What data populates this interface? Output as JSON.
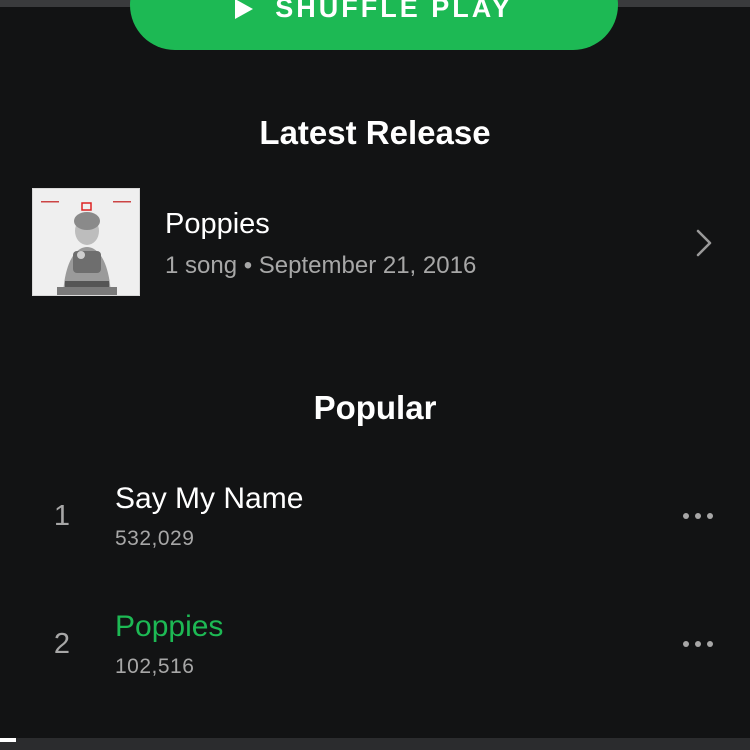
{
  "shuffle": {
    "label": "SHUFFLE PLAY"
  },
  "latest_release": {
    "heading": "Latest Release",
    "title": "Poppies",
    "meta": "1 song • September 21, 2016"
  },
  "popular": {
    "heading": "Popular",
    "tracks": [
      {
        "number": "1",
        "title": "Say My Name",
        "plays": "532,029",
        "playing": false
      },
      {
        "number": "2",
        "title": "Poppies",
        "plays": "102,516",
        "playing": true
      }
    ]
  },
  "colors": {
    "background": "#121314",
    "accent": "#1db954",
    "secondary_text": "#a7a7a7"
  },
  "icons": [
    "play-icon",
    "chevron-right-icon",
    "more-options-icon",
    "album-art"
  ],
  "playback_progress": 0.02
}
